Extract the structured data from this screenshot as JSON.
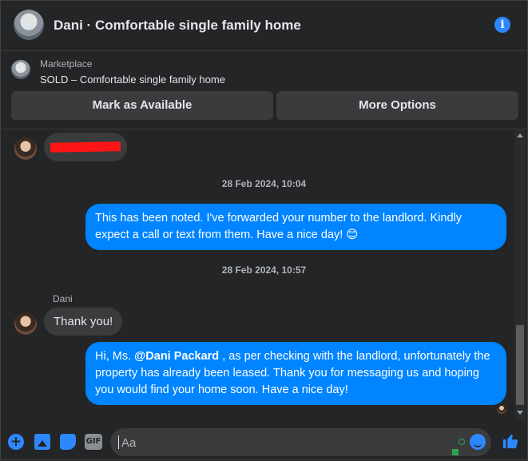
{
  "header": {
    "title": "Dani · Comfortable single family home"
  },
  "marketplace": {
    "label": "Marketplace",
    "listing": "SOLD – Comfortable single family home",
    "mark_available": "Mark as Available",
    "more_options": "More Options"
  },
  "messages": {
    "time1": "28 Feb 2024, 10:04",
    "out1": "This has been noted. I've forwarded your number to the landlord. Kindly expect a call or text from them. Have a nice day! 😊",
    "time2": "28 Feb 2024, 10:57",
    "sender": "Dani",
    "in1": "Thank you!",
    "out2_pre": "Hi, Ms. ",
    "out2_mention": "@Dani Packard",
    "out2_post": " , as per checking with the landlord, unfortunately the property has already been leased. Thank you for messaging us and hoping you would find your home soon. Have a nice day!"
  },
  "composer": {
    "placeholder": "Aa",
    "gif": "GIF"
  },
  "colors": {
    "accent": "#0084ff",
    "icon_blue": "#2d88ff",
    "bubble_in": "#3a3b3c",
    "bg": "#242526"
  }
}
